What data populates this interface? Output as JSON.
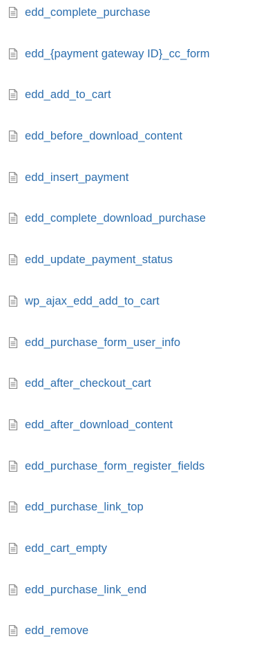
{
  "hooks": {
    "icon": "document-icon",
    "link_color": "#2b6dad",
    "icon_color": "#8c8c8c",
    "items": [
      {
        "label": "edd_complete_purchase"
      },
      {
        "label": "edd_{payment gateway ID}_cc_form"
      },
      {
        "label": "edd_add_to_cart"
      },
      {
        "label": "edd_before_download_content"
      },
      {
        "label": "edd_insert_payment"
      },
      {
        "label": "edd_complete_download_purchase"
      },
      {
        "label": "edd_update_payment_status"
      },
      {
        "label": "wp_ajax_edd_add_to_cart"
      },
      {
        "label": "edd_purchase_form_user_info"
      },
      {
        "label": "edd_after_checkout_cart"
      },
      {
        "label": "edd_after_download_content"
      },
      {
        "label": "edd_purchase_form_register_fields"
      },
      {
        "label": "edd_purchase_link_top"
      },
      {
        "label": "edd_cart_empty"
      },
      {
        "label": "edd_purchase_link_end"
      },
      {
        "label": "edd_remove"
      }
    ]
  }
}
